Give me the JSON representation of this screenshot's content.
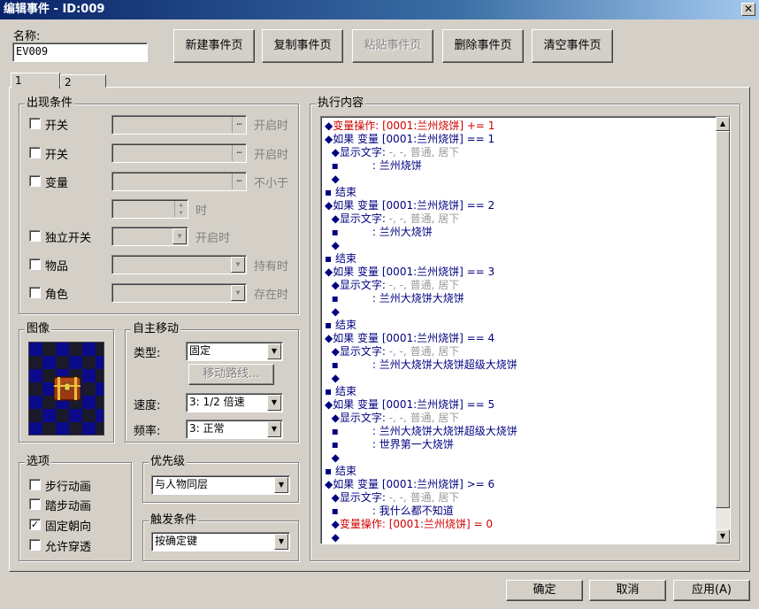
{
  "window": {
    "title": "编辑事件 - ID:009",
    "close_glyph": "✕"
  },
  "name": {
    "label": "名称:",
    "value": "EV009"
  },
  "toolbar": {
    "new_page": "新建事件页",
    "copy_page": "复制事件页",
    "paste_page": "粘贴事件页",
    "delete_page": "删除事件页",
    "clear_page": "清空事件页"
  },
  "tabs": [
    "1",
    "2"
  ],
  "conditions": {
    "title": "出现条件",
    "switch1": {
      "label": "开关",
      "suffix": "开启时"
    },
    "switch2": {
      "label": "开关",
      "suffix": "开启时"
    },
    "variable": {
      "label": "变量",
      "suffix": "不小于",
      "time_suffix": "时"
    },
    "self_switch": {
      "label": "独立开关",
      "suffix": "开启时"
    },
    "item": {
      "label": "物品",
      "suffix": "持有时"
    },
    "actor": {
      "label": "角色",
      "suffix": "存在时"
    }
  },
  "image": {
    "title": "图像"
  },
  "movement": {
    "title": "自主移动",
    "type_label": "类型:",
    "type_value": "固定",
    "route_button": "移动路线...",
    "speed_label": "速度:",
    "speed_value": "3: 1/2 倍速",
    "freq_label": "频率:",
    "freq_value": "3: 正常"
  },
  "options": {
    "title": "选项",
    "walk_anim": {
      "label": "步行动画",
      "checked": false
    },
    "step_anim": {
      "label": "踏步动画",
      "checked": false
    },
    "direction_fix": {
      "label": "固定朝向",
      "checked": true
    },
    "through": {
      "label": "允许穿透",
      "checked": false
    },
    "check_mark": "✓"
  },
  "priority": {
    "title": "优先级",
    "value": "与人物同层"
  },
  "trigger": {
    "title": "触发条件",
    "value": "按确定键"
  },
  "contents": {
    "title": "执行内容",
    "lines": [
      [
        {
          "t": "◆",
          "c": "blk"
        },
        {
          "t": "变量操作: [0001:兰州烧饼] += 1",
          "c": "red"
        }
      ],
      [
        {
          "t": "◆",
          "c": "blk"
        },
        {
          "t": "如果 变量 [0001:兰州烧饼] == 1",
          "c": "blue"
        }
      ],
      [
        {
          "t": "  ◆",
          "c": "blk"
        },
        {
          "t": "显示文字:",
          "c": "blk"
        },
        {
          "t": " -, -, 普通, 居下",
          "c": "grey"
        }
      ],
      [
        {
          "t": "  ▪          ",
          "c": "blk"
        },
        {
          "t": ": 兰州烧饼",
          "c": "blk"
        }
      ],
      [
        {
          "t": "  ◆",
          "c": "blk"
        }
      ],
      [
        {
          "t": "▪ 结束",
          "c": "blue"
        }
      ],
      [
        {
          "t": "◆",
          "c": "blk"
        },
        {
          "t": "如果 变量 [0001:兰州烧饼] == 2",
          "c": "blue"
        }
      ],
      [
        {
          "t": "  ◆",
          "c": "blk"
        },
        {
          "t": "显示文字:",
          "c": "blk"
        },
        {
          "t": " -, -, 普通, 居下",
          "c": "grey"
        }
      ],
      [
        {
          "t": "  ▪          ",
          "c": "blk"
        },
        {
          "t": ": 兰州大烧饼",
          "c": "blk"
        }
      ],
      [
        {
          "t": "  ◆",
          "c": "blk"
        }
      ],
      [
        {
          "t": "▪ 结束",
          "c": "blue"
        }
      ],
      [
        {
          "t": "◆",
          "c": "blk"
        },
        {
          "t": "如果 变量 [0001:兰州烧饼] == 3",
          "c": "blue"
        }
      ],
      [
        {
          "t": "  ◆",
          "c": "blk"
        },
        {
          "t": "显示文字:",
          "c": "blk"
        },
        {
          "t": " -, -, 普通, 居下",
          "c": "grey"
        }
      ],
      [
        {
          "t": "  ▪          ",
          "c": "blk"
        },
        {
          "t": ": 兰州大烧饼大烧饼",
          "c": "blk"
        }
      ],
      [
        {
          "t": "  ◆",
          "c": "blk"
        }
      ],
      [
        {
          "t": "▪ 结束",
          "c": "blue"
        }
      ],
      [
        {
          "t": "◆",
          "c": "blk"
        },
        {
          "t": "如果 变量 [0001:兰州烧饼] == 4",
          "c": "blue"
        }
      ],
      [
        {
          "t": "  ◆",
          "c": "blk"
        },
        {
          "t": "显示文字:",
          "c": "blk"
        },
        {
          "t": " -, -, 普通, 居下",
          "c": "grey"
        }
      ],
      [
        {
          "t": "  ▪          ",
          "c": "blk"
        },
        {
          "t": ": 兰州大烧饼大烧饼超级大烧饼",
          "c": "blk"
        }
      ],
      [
        {
          "t": "  ◆",
          "c": "blk"
        }
      ],
      [
        {
          "t": "▪ 结束",
          "c": "blue"
        }
      ],
      [
        {
          "t": "◆",
          "c": "blk"
        },
        {
          "t": "如果 变量 [0001:兰州烧饼] == 5",
          "c": "blue"
        }
      ],
      [
        {
          "t": "  ◆",
          "c": "blk"
        },
        {
          "t": "显示文字:",
          "c": "blk"
        },
        {
          "t": " -, -, 普通, 居下",
          "c": "grey"
        }
      ],
      [
        {
          "t": "  ▪          ",
          "c": "blk"
        },
        {
          "t": ": 兰州大烧饼大烧饼超级大烧饼",
          "c": "blk"
        }
      ],
      [
        {
          "t": "  ▪          ",
          "c": "blk"
        },
        {
          "t": ": 世界第一大烧饼",
          "c": "blk"
        }
      ],
      [
        {
          "t": "  ◆",
          "c": "blk"
        }
      ],
      [
        {
          "t": "▪ 结束",
          "c": "blue"
        }
      ],
      [
        {
          "t": "◆",
          "c": "blk"
        },
        {
          "t": "如果 变量 [0001:兰州烧饼] >= 6",
          "c": "blue"
        }
      ],
      [
        {
          "t": "  ◆",
          "c": "blk"
        },
        {
          "t": "显示文字:",
          "c": "blk"
        },
        {
          "t": " -, -, 普通, 居下",
          "c": "grey"
        }
      ],
      [
        {
          "t": "  ▪          ",
          "c": "blk"
        },
        {
          "t": ": 我什么都不知道",
          "c": "blk"
        }
      ],
      [
        {
          "t": "  ◆",
          "c": "blk"
        },
        {
          "t": "变量操作: [0001:兰州烧饼] = 0",
          "c": "red"
        }
      ],
      [
        {
          "t": "  ◆",
          "c": "blk"
        }
      ]
    ]
  },
  "footer": {
    "ok": "确定",
    "cancel": "取消",
    "apply": "应用(A)"
  },
  "colors": {
    "title_bar": "#0a246a",
    "face": "#d4d0c8",
    "sprite_bg_a": "#0a0a8a",
    "sprite_bg_b": "#1a1a2a"
  }
}
